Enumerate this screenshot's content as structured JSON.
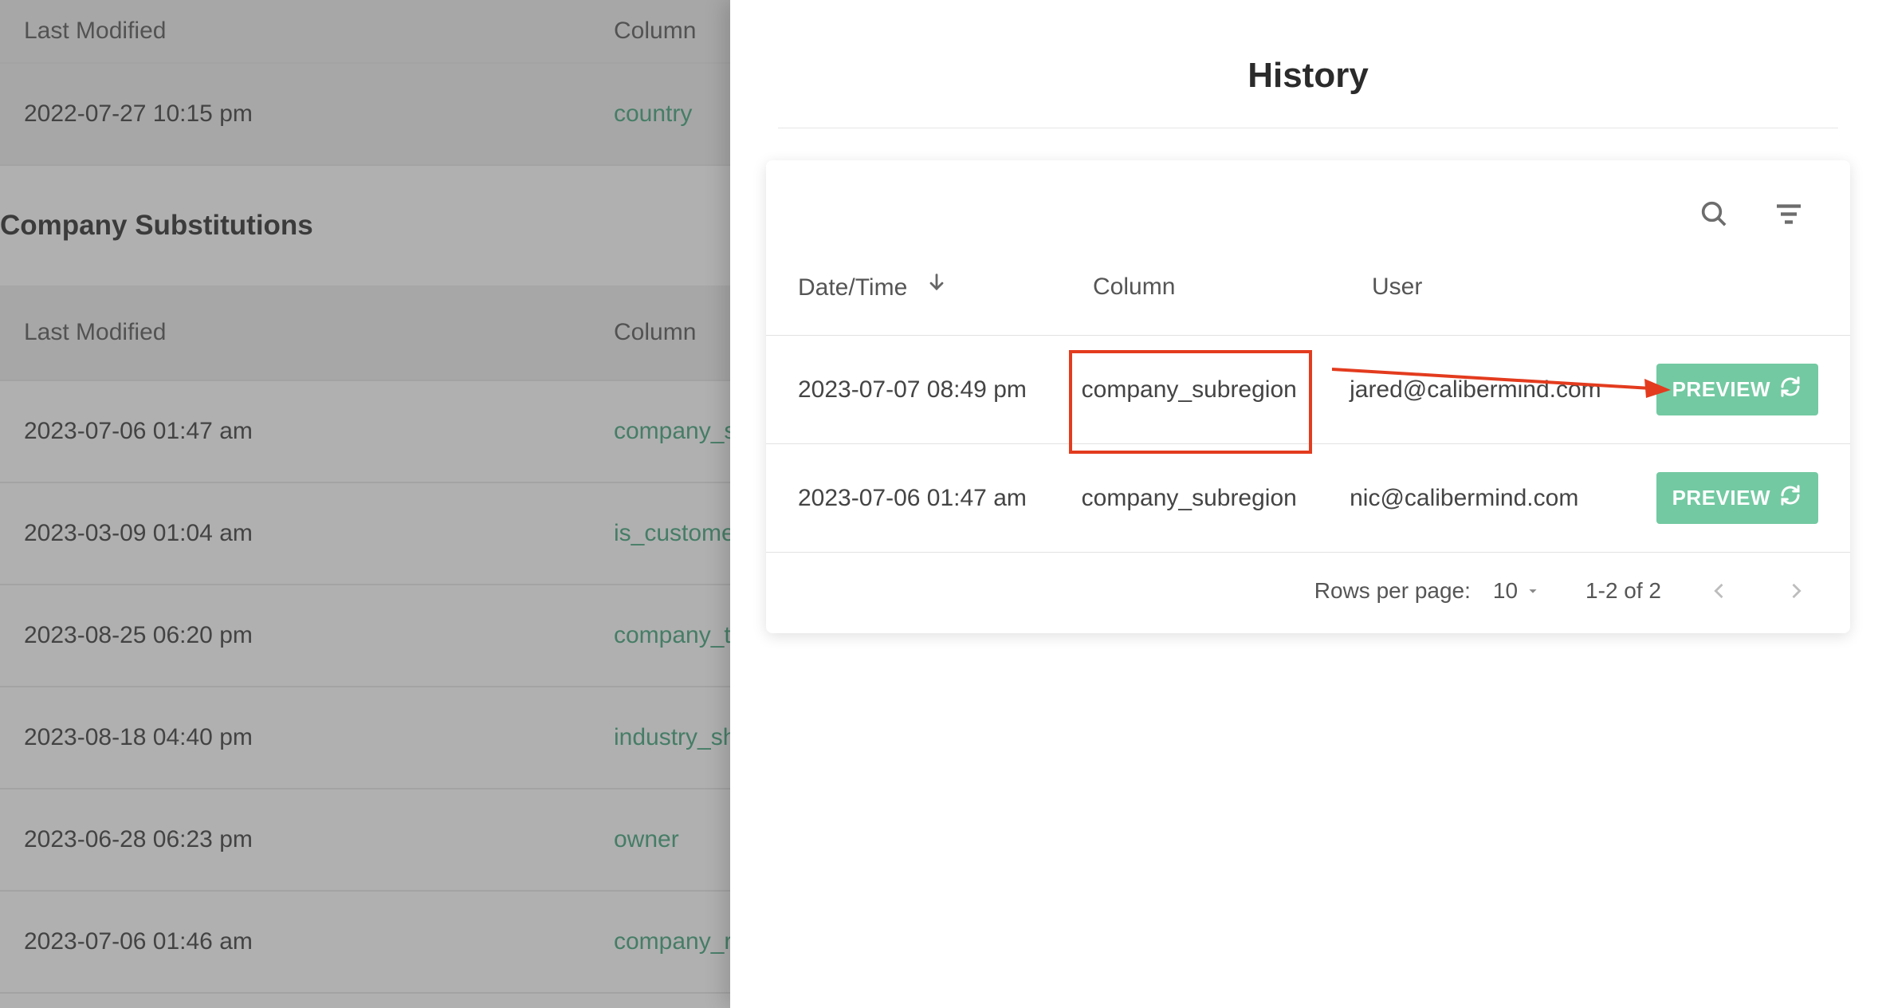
{
  "background": {
    "top_table": {
      "headers": {
        "date": "Last Modified",
        "column": "Column"
      },
      "rows": [
        {
          "date": "2022-07-27 10:15 pm",
          "column": "country"
        }
      ]
    },
    "section_title": "Company Substitutions",
    "bottom_table": {
      "headers": {
        "date": "Last Modified",
        "column": "Column"
      },
      "rows": [
        {
          "date": "2023-07-06 01:47 am",
          "column": "company_su"
        },
        {
          "date": "2023-03-09 01:04 am",
          "column": "is_customer"
        },
        {
          "date": "2023-08-25 06:20 pm",
          "column": "company_ti"
        },
        {
          "date": "2023-08-18 04:40 pm",
          "column": "industry_sh"
        },
        {
          "date": "2023-06-28 06:23 pm",
          "column": "owner"
        },
        {
          "date": "2023-07-06 01:46 am",
          "column": "company_re"
        }
      ]
    }
  },
  "panel": {
    "title": "History",
    "columns": {
      "date": "Date/Time",
      "column": "Column",
      "user": "User"
    },
    "rows": [
      {
        "date": "2023-07-07 08:49 pm",
        "column": "company_subregion",
        "user": "jared@calibermind.com",
        "btn": "PREVIEW"
      },
      {
        "date": "2023-07-06 01:47 am",
        "column": "company_subregion",
        "user": "nic@calibermind.com",
        "btn": "PREVIEW"
      }
    ],
    "pagination": {
      "rows_label": "Rows per page:",
      "rows_value": "10",
      "range": "1-2 of 2"
    }
  }
}
